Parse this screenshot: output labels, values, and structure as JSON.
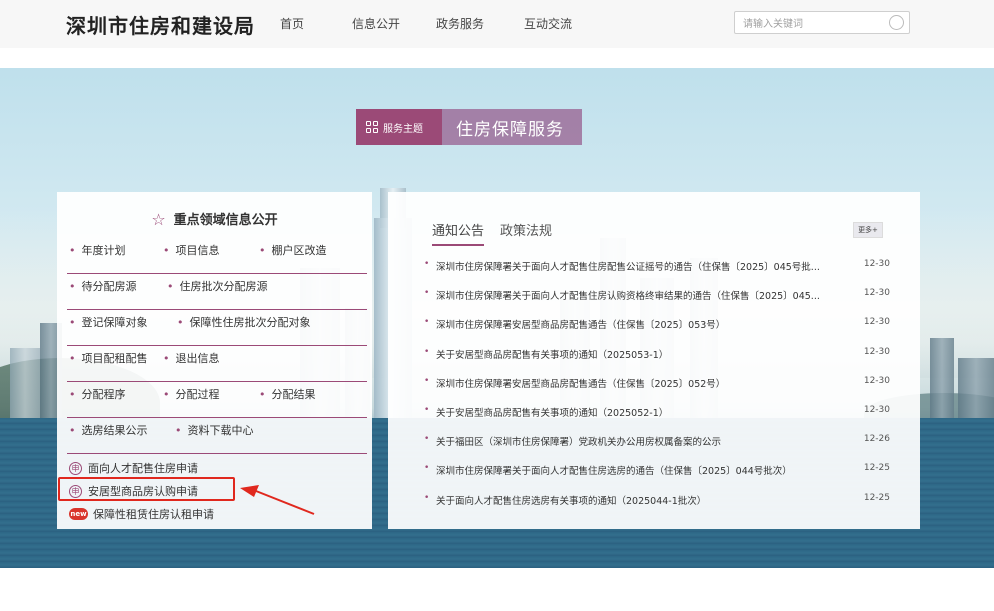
{
  "header": {
    "site_title": "深圳市住房和建设局",
    "nav": [
      "首页",
      "信息公开",
      "政务服务",
      "互动交流"
    ],
    "search_placeholder": "请输入关键词"
  },
  "theme_tag": {
    "label": "服务主题",
    "title": "住房保障服务"
  },
  "focus_panel": {
    "title": "重点领域信息公开",
    "rows": [
      [
        "年度计划",
        "项目信息",
        "棚户区改造"
      ],
      [
        "待分配房源",
        "住房批次分配房源"
      ],
      [
        "登记保障对象",
        "保障性住房批次分配对象"
      ],
      [
        "项目配租配售",
        "退出信息"
      ],
      [
        "分配程序",
        "分配过程",
        "分配结果"
      ],
      [
        "选房结果公示",
        "资料下载中心"
      ]
    ],
    "applications": [
      {
        "label": "面向人才配售住房申请",
        "icon": "application-icon"
      },
      {
        "label": "安居型商品房认购申请",
        "icon": "application-icon"
      },
      {
        "label": "保障性租赁住房认租申请",
        "icon": "new-badge-icon",
        "badge": "new"
      }
    ]
  },
  "notice_panel": {
    "tabs": [
      "通知公告",
      "政策法规"
    ],
    "active_tab": "通知公告",
    "more_label": "更多+",
    "items": [
      {
        "title": "深圳市住房保障署关于面向人才配售住房配售公证摇号的通告（住保售〔2025〕045号批...",
        "date": "12-30"
      },
      {
        "title": "深圳市住房保障署关于面向人才配售住房认购资格终审结果的通告（住保售〔2025〕045...",
        "date": "12-30"
      },
      {
        "title": "深圳市住房保障署安居型商品房配售通告（住保售〔2025〕053号）",
        "date": "12-30"
      },
      {
        "title": "关于安居型商品房配售有关事项的通知（2025053-1）",
        "date": "12-30"
      },
      {
        "title": "深圳市住房保障署安居型商品房配售通告（住保售〔2025〕052号）",
        "date": "12-30"
      },
      {
        "title": "关于安居型商品房配售有关事项的通知（2025052-1）",
        "date": "12-30"
      },
      {
        "title": "关于福田区（深圳市住房保障署）党政机关办公用房权属备案的公示",
        "date": "12-26"
      },
      {
        "title": "深圳市住房保障署关于面向人才配售住房选房的通告（住保售〔2025〕044号批次）",
        "date": "12-25"
      },
      {
        "title": "关于面向人才配售住房选房有关事项的通知（2025044-1批次）",
        "date": "12-25"
      }
    ]
  },
  "colors": {
    "accent": "#9b4a77",
    "highlight": "#e0281e"
  }
}
